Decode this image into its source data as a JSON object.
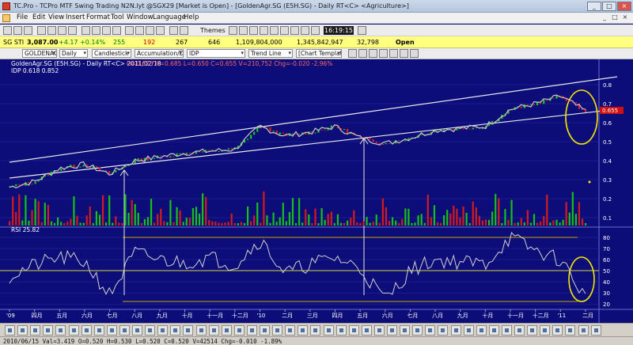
{
  "window": {
    "title": "TC.Pro - TCPro MTF Swing Trading N2N.lyt @SGX29 [Market is Open] - [GoldenAgr.SG (E5H.SG) - Daily RT<C> <Agriculture>]",
    "min": "_",
    "max": "□",
    "close": "×"
  },
  "menu": {
    "items": [
      "File",
      "Edit",
      "View",
      "Insert",
      "Format",
      "Tool",
      "Window",
      "Language",
      "Help"
    ]
  },
  "toolbar1": {
    "themes_label": "Themes",
    "clock": "16:19:15"
  },
  "ticker": {
    "index": "SG STI",
    "last": "3,087.00",
    "change": "+4.17",
    "change_pct": "+0.14%",
    "advances": "255",
    "declines": "192",
    "unchanged": "267",
    "nochange": "646",
    "volume": "1,109,804,000",
    "value": "1,345,842,947",
    "trades": "32,798",
    "status": "Open"
  },
  "toolbar2": {
    "symbol": "GOLDENAGR.S",
    "period": "Daily",
    "chart_type": "Candlestick",
    "indicator": "Accumulation/Distribution",
    "study": "IDP",
    "line": "Trend Line",
    "template": "[Chart Template]"
  },
  "chart": {
    "header": "GoldenAgr.SG (E5H.SG) - Daily RT<C>  2011/02/18",
    "ohlc": "O=0.675  H=0.685  L=0.650  C=0.655  V=210,752  Chg=-0.020  -2.96%",
    "idp": "IDP  0.618  0.852",
    "rsi_label": "RSI  25.82",
    "price_ticks": [
      "0.8",
      "0.7",
      "0.6",
      "0.5",
      "0.4",
      "0.3",
      "0.2",
      "0.1"
    ],
    "current_price": "0.655",
    "rsi_ticks": [
      "80",
      "70",
      "60",
      "50",
      "40",
      "30",
      "20"
    ],
    "x_labels": [
      "'09",
      "四月",
      "五月",
      "六月",
      "七月",
      "八月",
      "九月",
      "十月",
      "十一月",
      "十二月",
      "'10",
      "二月",
      "三月",
      "四月",
      "五月",
      "六月",
      "七月",
      "八月",
      "九月",
      "十月",
      "十一月",
      "十二月",
      "'11",
      "二月"
    ]
  },
  "chart_data": {
    "type": "line",
    "series": [
      {
        "name": "GoldenAgr.SG (E5H.SG)",
        "x": [
          "'09",
          "四月",
          "五月",
          "六月",
          "七月",
          "八月",
          "九月",
          "十月",
          "十一月",
          "十二月",
          "'10",
          "二月",
          "三月",
          "四月",
          "五月",
          "六月",
          "七月",
          "八月",
          "九月",
          "十月",
          "十一月",
          "十二月",
          "'11",
          "二月"
        ],
        "values": [
          0.26,
          0.29,
          0.36,
          0.38,
          0.33,
          0.4,
          0.42,
          0.44,
          0.45,
          0.46,
          0.58,
          0.53,
          0.55,
          0.58,
          0.52,
          0.49,
          0.52,
          0.56,
          0.57,
          0.58,
          0.67,
          0.7,
          0.74,
          0.66
        ]
      },
      {
        "name": "RSI",
        "x": [
          "'09",
          "四月",
          "五月",
          "六月",
          "七月",
          "八月",
          "九月",
          "十月",
          "十一月",
          "十二月",
          "'10",
          "二月",
          "三月",
          "四月",
          "五月",
          "六月",
          "七月",
          "八月",
          "九月",
          "十月",
          "十一月",
          "十二月",
          "'11",
          "二月"
        ],
        "values": [
          45,
          55,
          62,
          58,
          28,
          66,
          60,
          57,
          62,
          55,
          78,
          48,
          56,
          62,
          52,
          24,
          50,
          60,
          58,
          56,
          80,
          68,
          60,
          26
        ]
      }
    ],
    "ylim_price": [
      0.1,
      0.85
    ],
    "ylim_rsi": [
      18,
      85
    ]
  }
}
